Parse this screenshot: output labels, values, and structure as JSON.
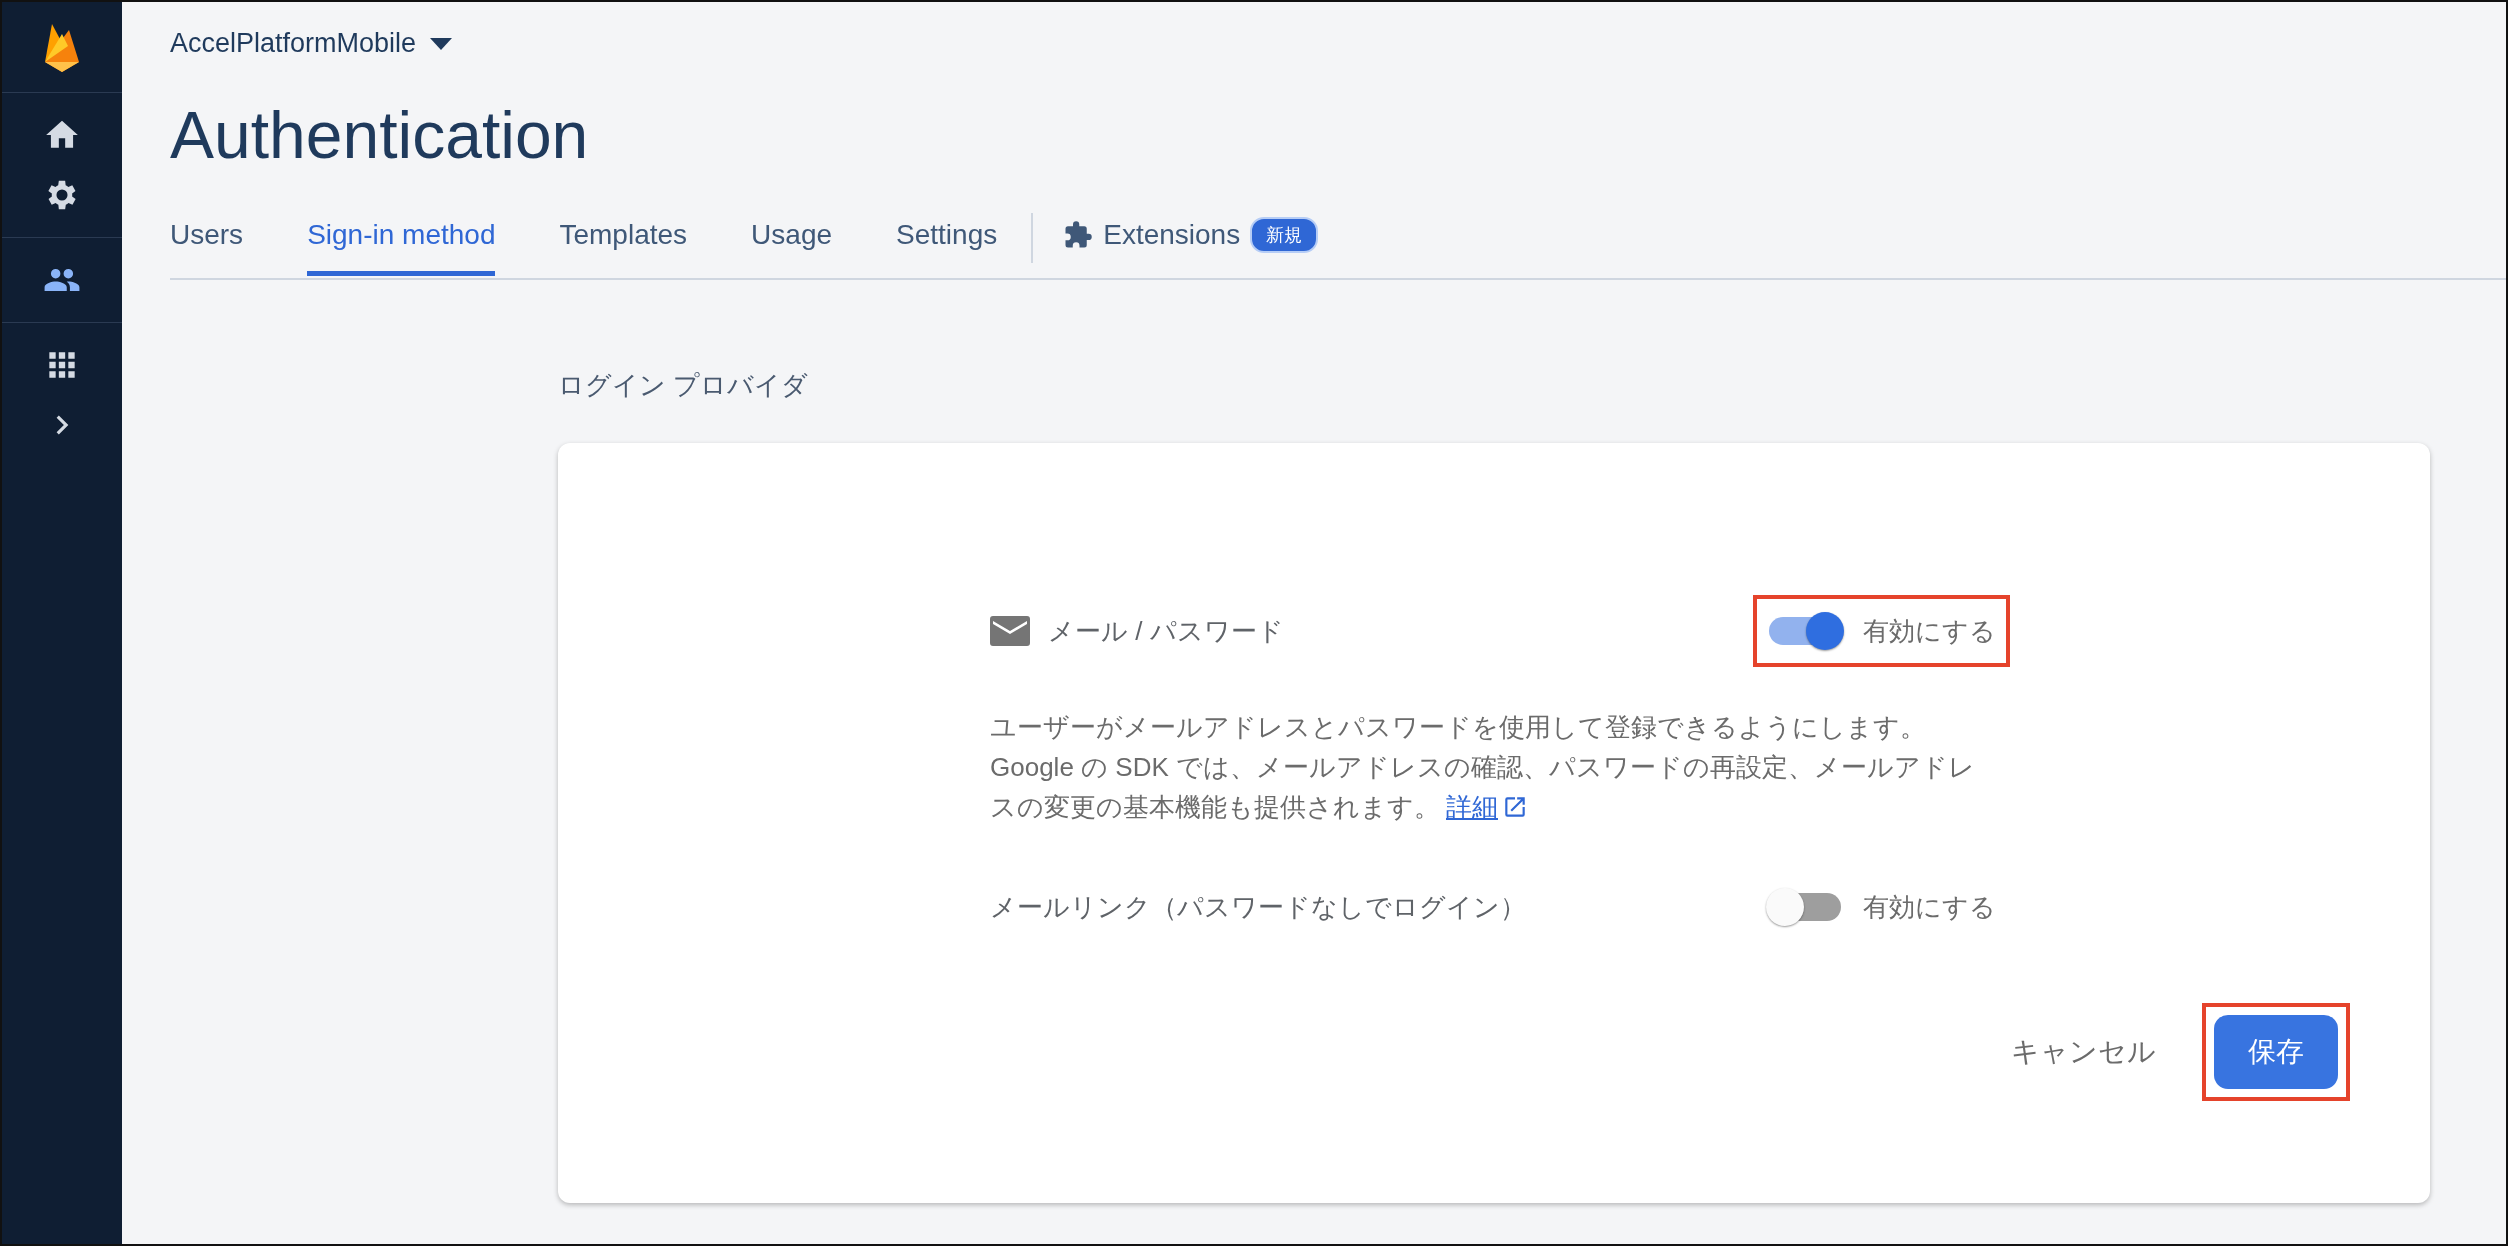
{
  "sidebar": {
    "items": [
      {
        "kind": "home",
        "selected": false
      },
      {
        "kind": "settings",
        "selected": false
      },
      {
        "kind": "people",
        "selected": true
      },
      {
        "kind": "apps",
        "selected": false
      },
      {
        "kind": "expand",
        "selected": false
      }
    ]
  },
  "header": {
    "project": "AccelPlatformMobile",
    "title": "Authentication"
  },
  "tabs": [
    {
      "label": "Users",
      "selected": false
    },
    {
      "label": "Sign-in method",
      "selected": true
    },
    {
      "label": "Templates",
      "selected": false
    },
    {
      "label": "Usage",
      "selected": false
    },
    {
      "label": "Settings",
      "selected": false
    },
    {
      "label": "Extensions",
      "selected": false,
      "badge": "新規"
    }
  ],
  "section_label": "ログイン プロバイダ",
  "provider": {
    "name": "メール / パスワード",
    "toggle": {
      "on": true,
      "label": "有効にする",
      "highlighted": true
    },
    "description": "ユーザーがメールアドレスとパスワードを使用して登録できるようにします。Google の SDK では、メールアドレスの確認、パスワードの再設定、メールアドレスの変更の基本機能も提供されます。",
    "link": "詳細"
  },
  "email_link": {
    "label": "メールリンク（パスワードなしでログイン）",
    "toggle": {
      "on": false,
      "label": "有効にする"
    }
  },
  "buttons": {
    "cancel": "キャンセル",
    "save": "保存",
    "save_highlighted": true
  }
}
